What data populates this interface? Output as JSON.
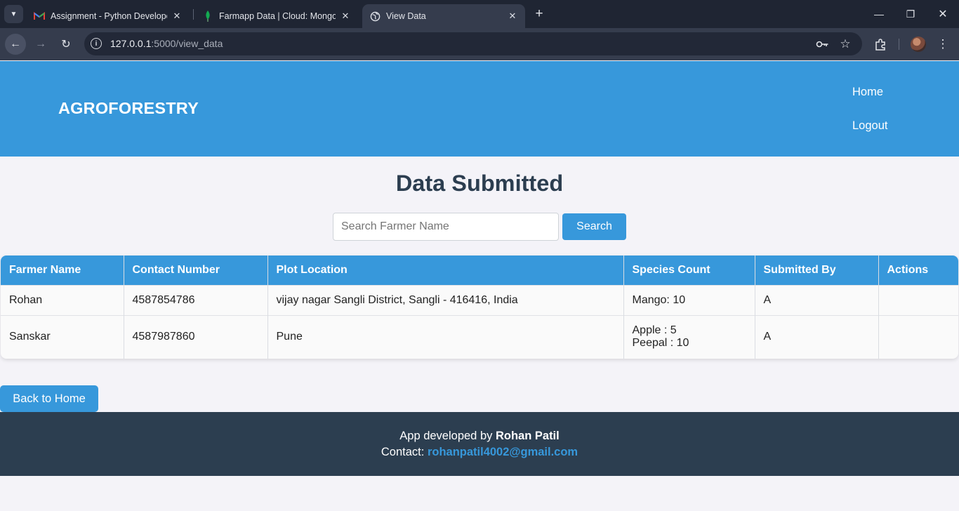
{
  "browser": {
    "tabs": [
      {
        "title": "Assignment - Python Developer",
        "icon": "gmail-icon"
      },
      {
        "title": "Farmapp Data | Cloud: MongoDB",
        "icon": "mongodb-leaf-icon"
      },
      {
        "title": "View Data",
        "icon": "globe-icon",
        "active": true
      }
    ],
    "url_host": "127.0.0.1",
    "url_rest": ":5000/view_data"
  },
  "header": {
    "brand": "AGROFORESTRY",
    "nav": [
      "Home",
      "Logout"
    ]
  },
  "main": {
    "title": "Data Submitted",
    "search_placeholder": "Search Farmer Name",
    "search_button": "Search",
    "table": {
      "columns": [
        "Farmer Name",
        "Contact Number",
        "Plot Location",
        "Species Count",
        "Submitted By",
        "Actions"
      ],
      "rows": [
        {
          "farmer": "Rohan",
          "contact": "4587854786",
          "location": "vijay nagar Sangli District, Sangli - 416416, India",
          "species": [
            "Mango: 10"
          ],
          "submitted_by": "A",
          "actions": ""
        },
        {
          "farmer": "Sanskar",
          "contact": "4587987860",
          "location": "Pune",
          "species": [
            "Apple : 5",
            "Peepal : 10"
          ],
          "submitted_by": "A",
          "actions": ""
        }
      ]
    },
    "back_button": "Back to Home"
  },
  "footer": {
    "developed_prefix": "App developed by ",
    "developer": "Rohan Patil",
    "contact_prefix": "Contact: ",
    "email": "rohanpatil4002@gmail.com"
  },
  "colors": {
    "primary": "#3798db",
    "dark": "#2c3e50",
    "page_bg": "#f4f3f8"
  }
}
